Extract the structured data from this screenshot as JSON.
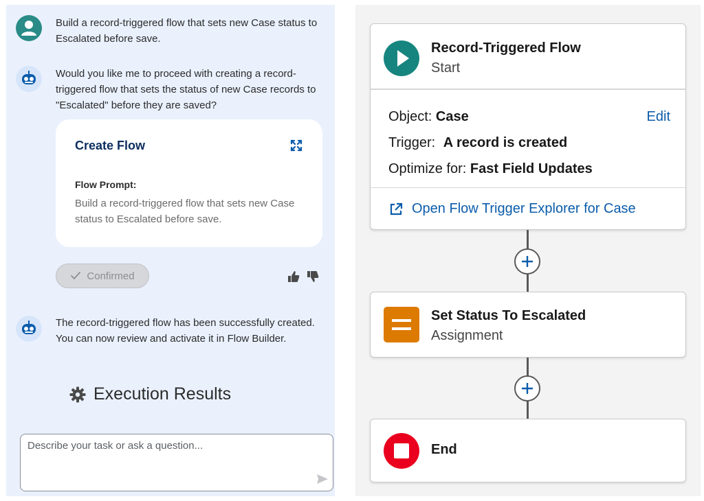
{
  "chat": {
    "user_message": "Build a record-triggered flow that sets new Case status to Escalated before save.",
    "bot_question": "Would you like me to proceed with creating a record-triggered flow that sets the status of new Case records to \"Escalated\" before they are saved?",
    "flow_card": {
      "title": "Create Flow",
      "prompt_label": "Flow Prompt:",
      "prompt_text": "Build a record-triggered flow that sets new Case status to Escalated before save."
    },
    "confirmed_label": "Confirmed",
    "bot_result": "The record-triggered flow has been successfully created. You can now review and activate it in Flow Builder.",
    "execution_results_title": "Execution Results",
    "input_placeholder": "Describe your task or ask a question..."
  },
  "flow": {
    "start": {
      "title": "Record-Triggered Flow",
      "subtitle": "Start",
      "object_label": "Object:",
      "object_value": "Case",
      "edit_label": "Edit",
      "trigger_label": "Trigger:",
      "trigger_value": "A record is created",
      "optimize_label": "Optimize for:",
      "optimize_value": "Fast Field Updates",
      "explorer_link": "Open Flow Trigger Explorer for Case"
    },
    "assignment": {
      "title": "Set Status To Escalated",
      "subtitle": "Assignment"
    },
    "end": {
      "title": "End"
    }
  },
  "colors": {
    "chat_bg": "#eaf1fd",
    "start_icon": "#17857f",
    "assignment_icon": "#dd7a01",
    "end_icon": "#ea001e",
    "link": "#0b5cab"
  },
  "icons": [
    "user-avatar-icon",
    "bot-avatar-icon",
    "expand-icon",
    "check-icon",
    "thumbs-up-icon",
    "thumbs-down-icon",
    "gear-icon",
    "send-icon",
    "play-icon",
    "assignment-icon",
    "stop-icon",
    "external-link-icon",
    "plus-icon"
  ]
}
